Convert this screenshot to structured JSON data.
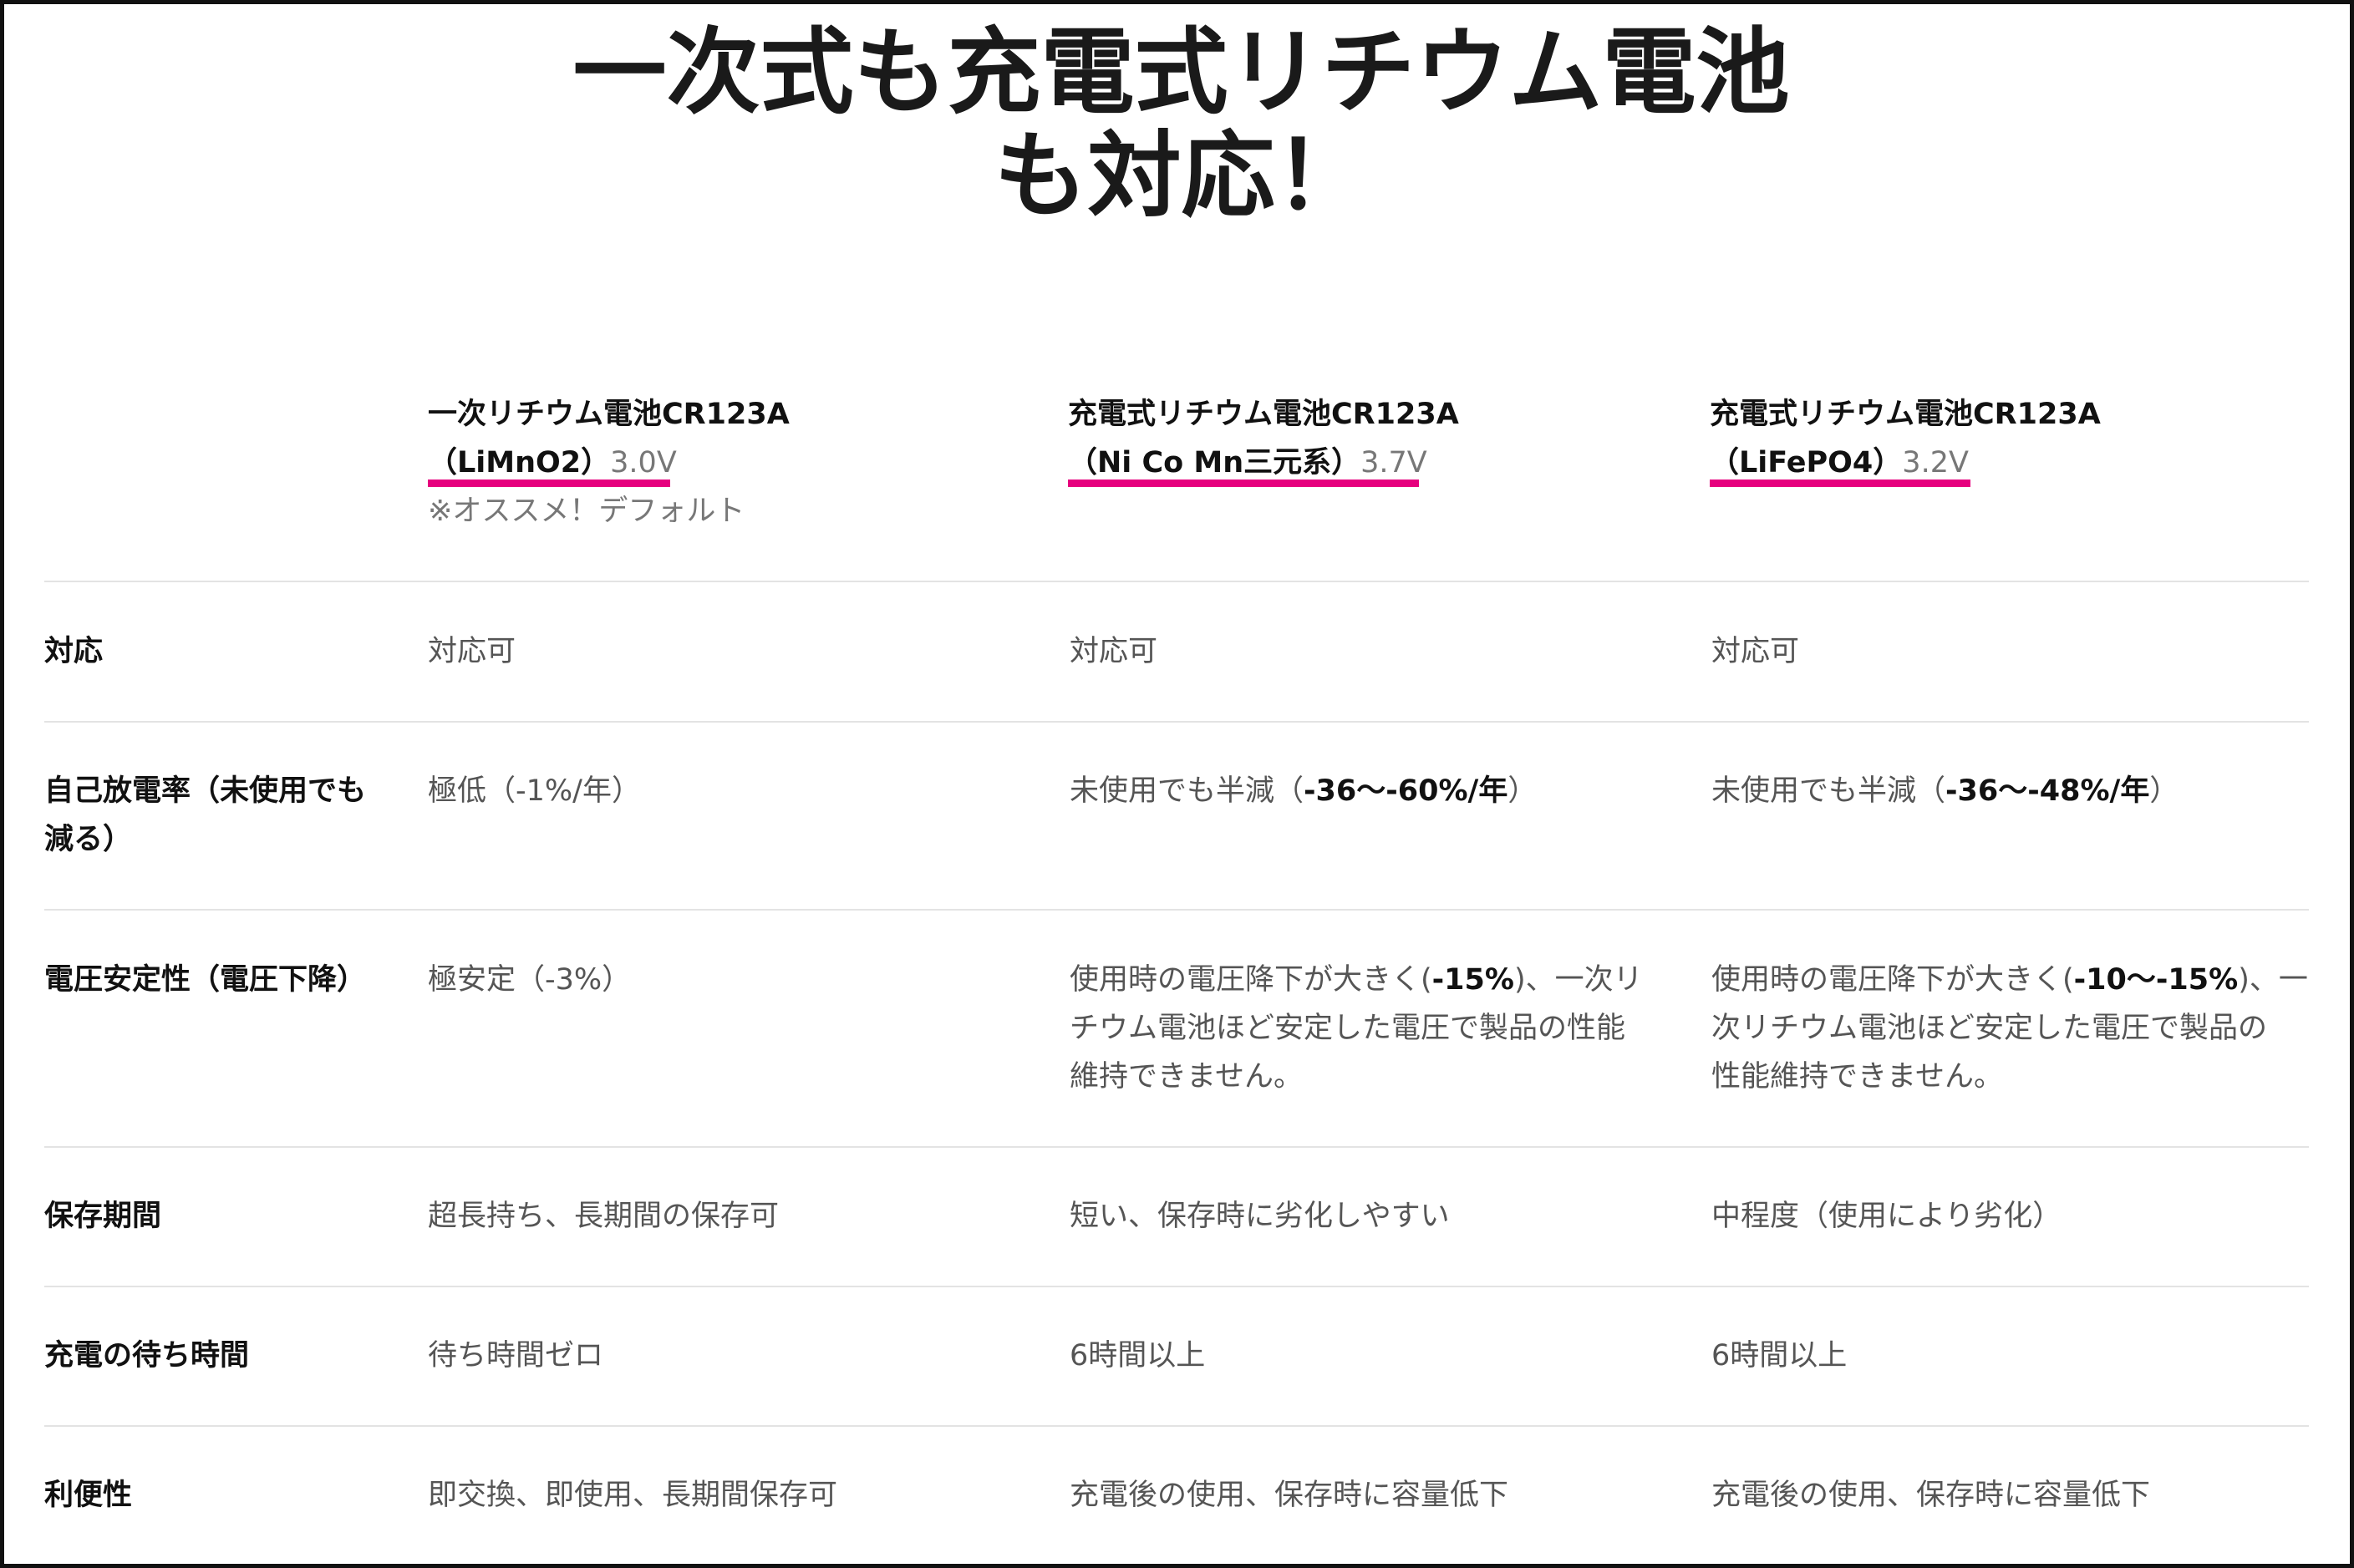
{
  "title": {
    "line1": "一次式も充電式リチウム電池",
    "line2": "も対応！"
  },
  "columns": [
    {
      "name": "一次リチウム電池CR123A",
      "chem": "（LiMnO2）",
      "volt": "3.0V",
      "note": "※オススメ！デフォルト"
    },
    {
      "name": "充電式リチウム電池CR123A",
      "chem": "（Ni Co Mn三元系）",
      "volt": "3.7V",
      "note": ""
    },
    {
      "name": "充電式リチウム電池CR123A",
      "chem": "（LiFePO4）",
      "volt": "3.2V",
      "note": ""
    }
  ],
  "accent_color": "#e6007e",
  "rows": [
    {
      "label": "対応",
      "cells": [
        "対応可",
        "対応可",
        "対応可"
      ]
    },
    {
      "label_line1": "自己放電率（未使用でも",
      "label_line2": "減る）",
      "c1": "極低（-1%/年）",
      "c2_pre": "未使用でも半減（",
      "c2_bold": "-36〜-60%/年",
      "c2_post": "）",
      "c3_pre": "未使用でも半減（",
      "c3_bold": "-36〜-48%/年",
      "c3_post": "）"
    },
    {
      "label": "電圧安定性（電圧下降）",
      "c1": "極安定（-3%）",
      "c2_l1_pre": "使用時の電圧降下が大きく(",
      "c2_l1_bold": "-15%",
      "c2_l1_post": ")、一次リ",
      "c2_l2": "チウム電池ほど安定した電圧で製品の性能",
      "c2_l3": "維持できません。",
      "c3_l1_pre": "使用時の電圧降下が大きく(",
      "c3_l1_bold": "-10〜-15%",
      "c3_l1_post": ")、一",
      "c3_l2": "次リチウム電池ほど安定した電圧で製品の",
      "c3_l3": "性能維持できません。"
    },
    {
      "label": "保存期間",
      "cells": [
        "超長持ち、長期間の保存可",
        "短い、保存時に劣化しやすい",
        "中程度（使用により劣化）"
      ]
    },
    {
      "label": "充電の待ち時間",
      "cells": [
        "待ち時間ゼロ",
        "6時間以上",
        "6時間以上"
      ]
    },
    {
      "label": "利便性",
      "cells": [
        "即交換、即使用、長期間保存可",
        "充電後の使用、保存時に容量低下",
        "充電後の使用、保存時に容量低下"
      ]
    }
  ]
}
